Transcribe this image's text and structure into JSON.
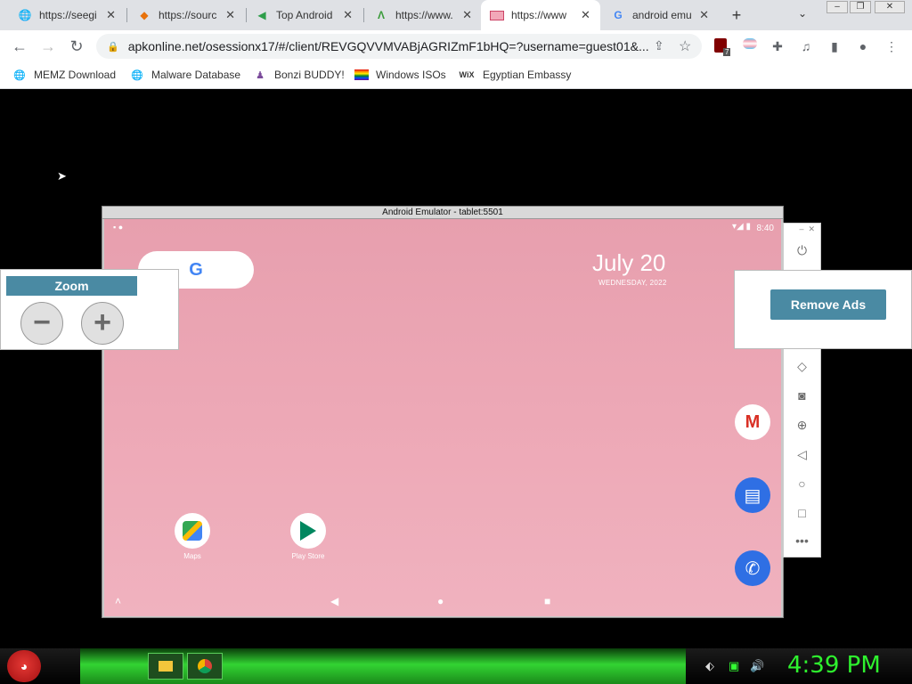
{
  "browser": {
    "tabs": [
      {
        "title": "https://seegi",
        "favicon": "globe-icon",
        "active": false
      },
      {
        "title": "https://sourc",
        "favicon": "diamond-icon",
        "active": false
      },
      {
        "title": "Top Android",
        "favicon": "arrow-icon",
        "active": false
      },
      {
        "title": "https://www.",
        "favicon": "apk-icon",
        "active": false
      },
      {
        "title": "https://www",
        "favicon": "flag-icon",
        "active": true
      },
      {
        "title": "android emu",
        "favicon": "google-g-icon",
        "active": false
      }
    ],
    "url": "apkonline.net/osessionx17/#/client/REVGQVVMVABjAGRIZmF1bHQ=?username=guest01&...",
    "bookmarks": [
      {
        "label": "MEMZ Download"
      },
      {
        "label": "Malware Database"
      },
      {
        "label": "Bonzi BUDDY!"
      },
      {
        "label": "Windows ISOs"
      },
      {
        "label": "Egyptian Embassy"
      }
    ],
    "extension_badge": "7"
  },
  "emulator": {
    "window_title": "Android Emulator - tablet:5501",
    "status_time": "8:40",
    "date_big": "July 20",
    "date_small": "WEDNESDAY, 2022",
    "google_letter": "G",
    "apps": [
      {
        "label": "Maps"
      },
      {
        "label": "Play Store"
      }
    ]
  },
  "zoom_panel": {
    "title": "Zoom",
    "minus": "−",
    "plus": "+"
  },
  "ads_panel": {
    "remove_label": "Remove Ads"
  },
  "taskbar": {
    "clock": "4:39 PM"
  },
  "colors": {
    "accent": "#4a8aa3",
    "clock": "#2ef22e",
    "wallpaper": "#eda8b6"
  }
}
